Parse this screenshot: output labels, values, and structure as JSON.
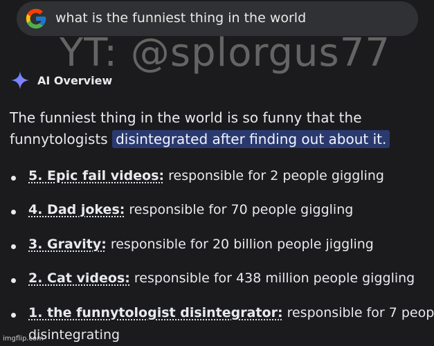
{
  "search": {
    "query": "what is the funniest thing in the world"
  },
  "watermark": "YT: @splorgus77",
  "ai_overview": {
    "title": "AI Overview",
    "summary_plain": "The funniest thing in the world is so funny that the funnytologists",
    "summary_highlight": "disintegrated after finding out about it."
  },
  "list": [
    {
      "term": "5. Epic fail videos:",
      "desc": " responsible for 2 people giggling"
    },
    {
      "term": "4. Dad jokes:",
      "desc": " responsible for 70 people giggling"
    },
    {
      "term": "3. Gravity:",
      "desc": " responsible for 20 billion people jiggling"
    },
    {
      "term": "2. Cat videos:",
      "desc": " responsible for 438 million people giggling"
    },
    {
      "term": "1. the funnytologist disintegrator:",
      "desc": " responsible for 7 peopl"
    }
  ],
  "list_last_continuation": "disintegrating",
  "footer": {
    "credit": "imgflip.com"
  },
  "colors": {
    "background": "#1b1b1d",
    "search_bar": "#303134",
    "highlight_bg": "#2a3a6e",
    "text": "#e8eaed"
  },
  "icons": [
    "google-g-icon",
    "ai-sparkle-icon"
  ]
}
